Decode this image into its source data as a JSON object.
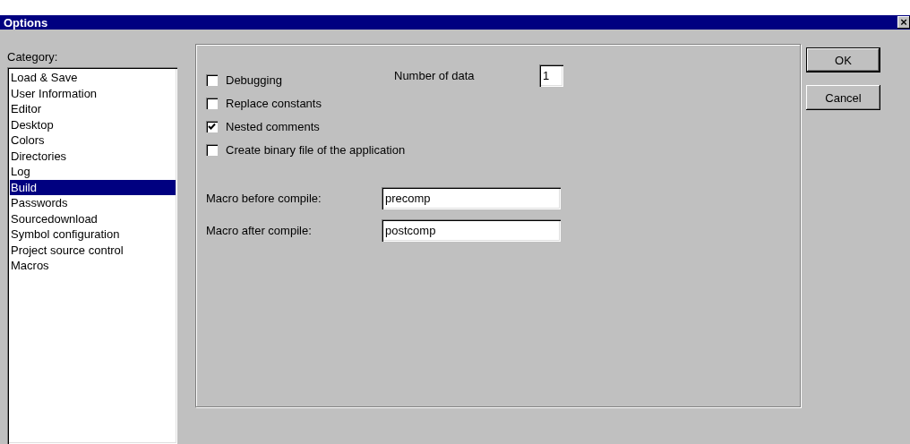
{
  "window": {
    "title": "Options",
    "close": "×"
  },
  "category_label": "Category:",
  "categories": [
    {
      "label": "Load & Save",
      "selected": false
    },
    {
      "label": "User Information",
      "selected": false
    },
    {
      "label": "Editor",
      "selected": false
    },
    {
      "label": "Desktop",
      "selected": false
    },
    {
      "label": "Colors",
      "selected": false
    },
    {
      "label": "Directories",
      "selected": false
    },
    {
      "label": "Log",
      "selected": false
    },
    {
      "label": "Build",
      "selected": true
    },
    {
      "label": "Passwords",
      "selected": false
    },
    {
      "label": "Sourcedownload",
      "selected": false
    },
    {
      "label": "Symbol configuration",
      "selected": false
    },
    {
      "label": "Project source control",
      "selected": false
    },
    {
      "label": "Macros",
      "selected": false
    }
  ],
  "checkboxes": [
    {
      "label": "Debugging",
      "checked": false
    },
    {
      "label": "Replace constants",
      "checked": false
    },
    {
      "label": "Nested comments",
      "checked": true
    },
    {
      "label": "Create binary file of the application",
      "checked": false
    }
  ],
  "number_of_data": {
    "label": "Number of data",
    "value": "1"
  },
  "macros": [
    {
      "label": "Macro before compile:",
      "value": "precomp"
    },
    {
      "label": "Macro after compile:",
      "value": "postcomp"
    }
  ],
  "buttons": [
    "OK",
    "Cancel"
  ]
}
